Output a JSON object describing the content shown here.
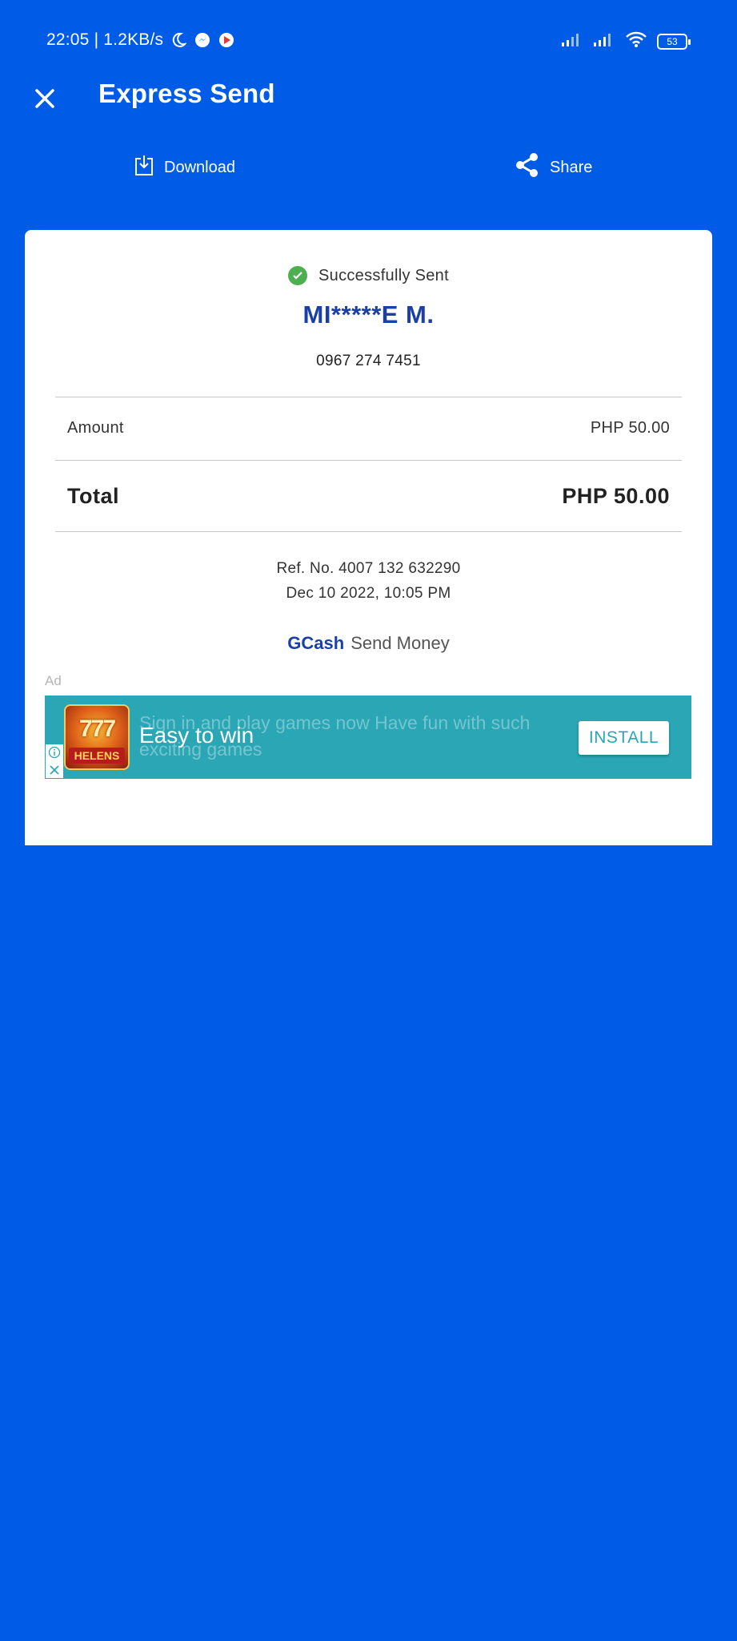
{
  "status_bar": {
    "time_network": "22:05 | 1.2KB/s",
    "battery": "53"
  },
  "header": {
    "title": "Express Send"
  },
  "actions": {
    "download_label": "Download",
    "share_label": "Share"
  },
  "receipt": {
    "status_text": "Successfully Sent",
    "recipient_name": "MI*****E M.",
    "recipient_number": "0967 274 7451",
    "amount_label": "Amount",
    "amount_value": "PHP 50.00",
    "total_label": "Total",
    "total_value": "PHP 50.00",
    "ref_no": "Ref. No. 4007 132 632290",
    "date": "Dec 10 2022, 10:05 PM",
    "brand": "GCash",
    "service": "Send Money"
  },
  "ad": {
    "label": "Ad",
    "description": "Sign in and play games now Have fun with such exciting games",
    "headline": "Easy to win",
    "install_label": "INSTALL",
    "app_icon_text": "HELENS",
    "app_icon_sevens": "777"
  },
  "colors": {
    "background": "#005ce6",
    "card": "#ffffff",
    "accent_name": "#1a3fa8",
    "success": "#4caf50",
    "ad_bg": "#2aa6b5"
  },
  "icons": {
    "close": "close-icon",
    "download": "download-icon",
    "share": "share-icon",
    "check": "check-circle-icon"
  }
}
